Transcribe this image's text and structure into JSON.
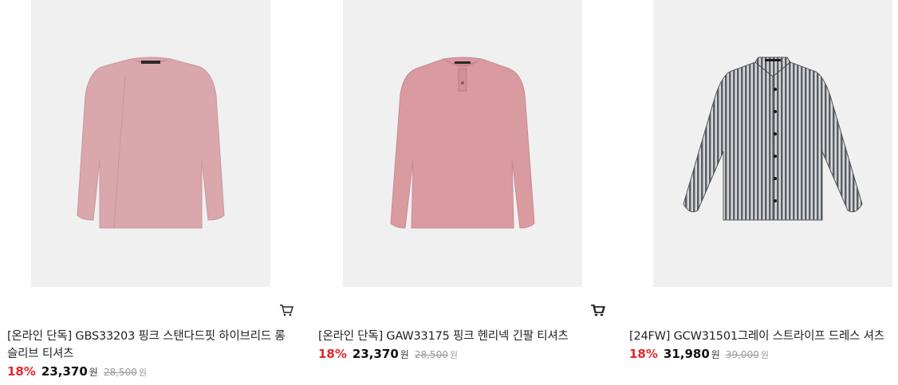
{
  "products": [
    {
      "name": "[온라인 단독] GBS33203 핑크 스탠다드핏 하이브리드 롱슬리브 티셔츠",
      "discount": "18%",
      "price": "23,370",
      "currency": "원",
      "original_price": "28,500",
      "original_currency": "원",
      "image": "pink-long-sleeve-tshirt",
      "color": "#d9a7ac"
    },
    {
      "name": "[온라인 단독] GAW33175 핑크 헨리넥 긴팔 티셔츠",
      "discount": "18%",
      "price": "23,370",
      "currency": "원",
      "original_price": "28,500",
      "original_currency": "원",
      "image": "pink-henley-tshirt",
      "color": "#d99ba0"
    },
    {
      "name": "[24FW] GCW31501그레이 스트라이프 드레스 셔츠",
      "discount": "18%",
      "price": "31,980",
      "currency": "원",
      "original_price": "39,000",
      "original_currency": "원",
      "image": "gray-stripe-dress-shirt",
      "color": "#6b6f75"
    }
  ],
  "icons": {
    "cart": "cart-icon"
  },
  "colors": {
    "discount": "#e4262b",
    "thumbnail_bg": "#f0f0f0"
  }
}
